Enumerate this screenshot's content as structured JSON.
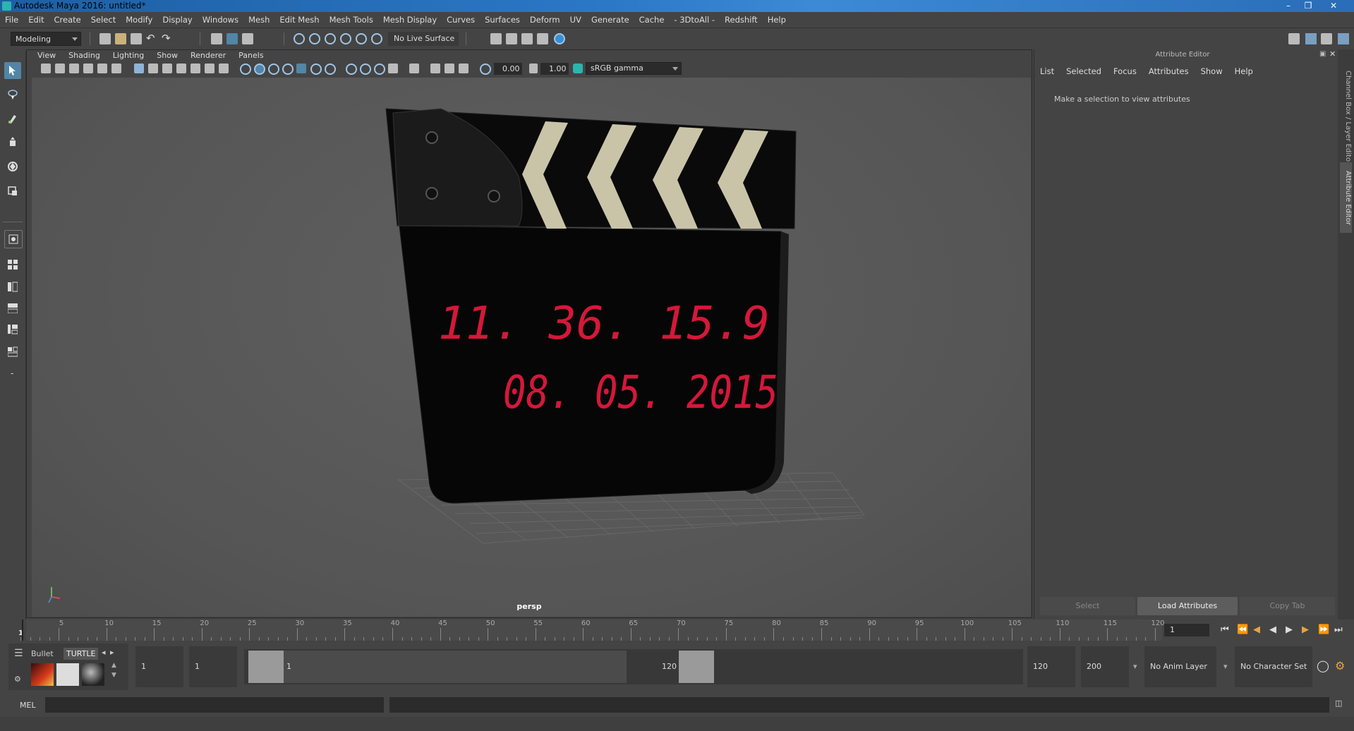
{
  "window": {
    "title": "Autodesk Maya 2016: untitled*"
  },
  "menubar": [
    "File",
    "Edit",
    "Create",
    "Select",
    "Modify",
    "Display",
    "Windows",
    "Mesh",
    "Edit Mesh",
    "Mesh Tools",
    "Mesh Display",
    "Curves",
    "Surfaces",
    "Deform",
    "UV",
    "Generate",
    "Cache",
    "- 3DtoAll -",
    "Redshift",
    "Help"
  ],
  "statusline": {
    "mode": "Modeling",
    "live_surface": "No Live Surface"
  },
  "viewport": {
    "menus": [
      "View",
      "Shading",
      "Lighting",
      "Show",
      "Renderer",
      "Panels"
    ],
    "field_a": "0.00",
    "field_b": "1.00",
    "colorspace": "sRGB gamma",
    "camera_label": "persp",
    "display_line1": "11. 36. 15.9",
    "display_line2": "08. 05. 2015"
  },
  "attribute_editor": {
    "header": "Attribute Editor",
    "menus": [
      "List",
      "Selected",
      "Focus",
      "Attributes",
      "Show",
      "Help"
    ],
    "hint": "Make a selection to view attributes",
    "buttons": {
      "select": "Select",
      "load": "Load Attributes",
      "copy": "Copy Tab"
    }
  },
  "side_tabs": {
    "channel_box": "Channel Box / Layer Editor",
    "attribute_editor": "Attribute Editor"
  },
  "timeslider": {
    "tick_labels": [
      "5",
      "10",
      "15",
      "20",
      "25",
      "30",
      "35",
      "40",
      "45",
      "50",
      "55",
      "60",
      "65",
      "70",
      "75",
      "80",
      "85",
      "90",
      "95",
      "100",
      "105",
      "110",
      "115",
      "120"
    ],
    "start_label": "1",
    "current_frame": "1"
  },
  "shelf": {
    "tabs": [
      "Bullet",
      "TURTLE"
    ]
  },
  "range": {
    "start": "1",
    "playback_start": "1",
    "range_start_label": "1",
    "range_end_label": "120",
    "playback_end": "120",
    "end": "200",
    "anim_layer": "No Anim Layer",
    "character_set": "No Character Set"
  },
  "commandline": {
    "label": "MEL"
  },
  "colors": {
    "accent": "#5285a6",
    "display_red": "#d4183a",
    "titlebar": "#2b78c7"
  }
}
